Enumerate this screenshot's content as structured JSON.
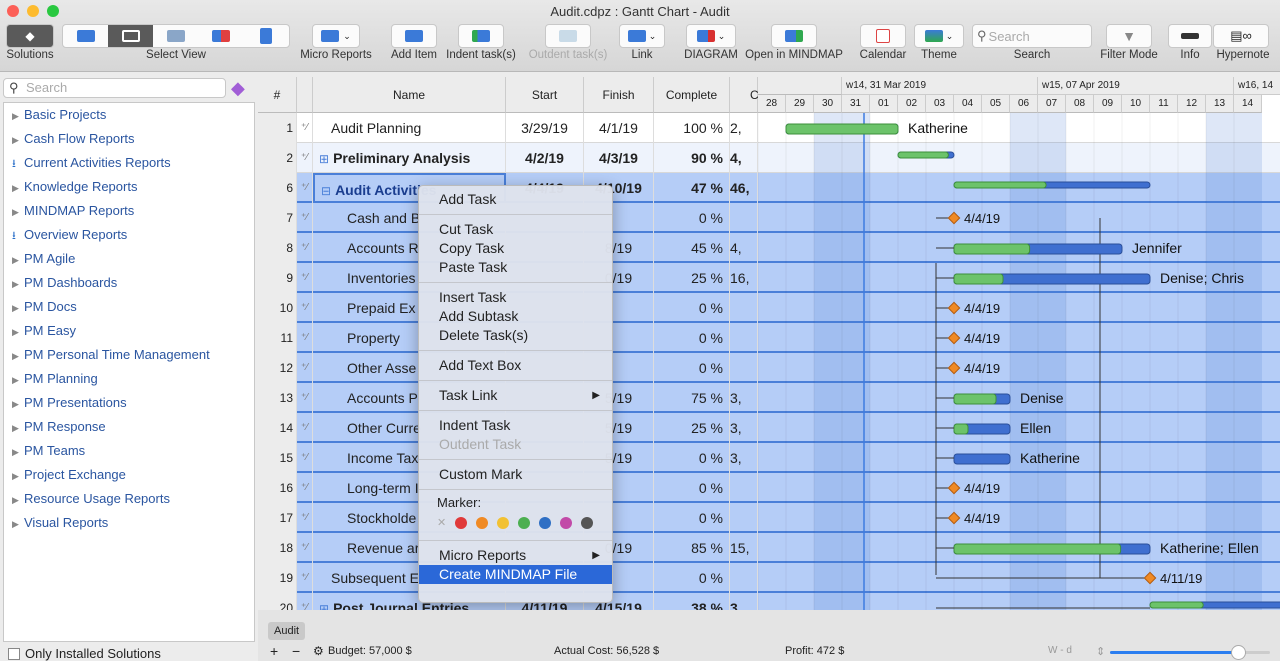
{
  "window": {
    "title": "Audit.cdpz : Gantt Chart - Audit"
  },
  "toolbar": {
    "solutions": "Solutions",
    "select_view": "Select View",
    "micro_reports": "Micro Reports",
    "add_item": "Add Item",
    "indent": "Indent task(s)",
    "outdent": "Outdent task(s)",
    "link": "Link",
    "diagram": "DIAGRAM",
    "open_mindmap": "Open in MINDMAP",
    "calendar": "Calendar",
    "theme": "Theme",
    "search_placeholder": "Search",
    "search": "Search",
    "filter_mode": "Filter Mode",
    "info": "Info",
    "hypernote": "Hypernote"
  },
  "sidebar": {
    "search_placeholder": "Search",
    "items": [
      {
        "label": "Basic Projects",
        "icon": "triangle"
      },
      {
        "label": "Cash Flow Reports",
        "icon": "triangle"
      },
      {
        "label": "Current Activities Reports",
        "icon": "download"
      },
      {
        "label": "Knowledge Reports",
        "icon": "triangle"
      },
      {
        "label": "MINDMAP Reports",
        "icon": "triangle"
      },
      {
        "label": "Overview Reports",
        "icon": "download"
      },
      {
        "label": "PM Agile",
        "icon": "triangle"
      },
      {
        "label": "PM Dashboards",
        "icon": "triangle"
      },
      {
        "label": "PM Docs",
        "icon": "triangle"
      },
      {
        "label": "PM Easy",
        "icon": "triangle"
      },
      {
        "label": "PM Personal Time Management",
        "icon": "triangle"
      },
      {
        "label": "PM Planning",
        "icon": "triangle"
      },
      {
        "label": "PM Presentations",
        "icon": "triangle"
      },
      {
        "label": "PM Response",
        "icon": "triangle"
      },
      {
        "label": "PM Teams",
        "icon": "triangle"
      },
      {
        "label": "Project Exchange",
        "icon": "triangle"
      },
      {
        "label": "Resource Usage Reports",
        "icon": "triangle"
      },
      {
        "label": "Visual Reports",
        "icon": "triangle"
      }
    ],
    "only_installed": "Only Installed Solutions"
  },
  "table": {
    "headers": {
      "num": "#",
      "name": "Name",
      "start": "Start",
      "finish": "Finish",
      "complete": "Complete",
      "cost": "C"
    },
    "rows": [
      {
        "num": "1",
        "name": "Audit Planning",
        "start": "3/29/19",
        "finish": "4/1/19",
        "complete": "100 %",
        "cost": "2,",
        "bold": false,
        "expander": "",
        "type": "bar",
        "s": "2019-03-29",
        "e": "2019-04-01",
        "progress": 100,
        "resource": "Katherine"
      },
      {
        "num": "2",
        "name": "Preliminary Analysis",
        "start": "4/2/19",
        "finish": "4/3/19",
        "complete": "90 %",
        "cost": "4,",
        "bold": true,
        "expander": "+",
        "type": "summary",
        "s": "2019-04-02",
        "e": "2019-04-03",
        "progress": 90,
        "resource": ""
      },
      {
        "num": "6",
        "name": "Audit Activities",
        "start": "4/4/19",
        "finish": "4/10/19",
        "complete": "47 %",
        "cost": "46,",
        "bold": true,
        "expander": "−",
        "type": "summary",
        "s": "2019-04-04",
        "e": "2019-04-10",
        "progress": 47,
        "resource": ""
      },
      {
        "num": "7",
        "name": "Cash and B",
        "start": "",
        "finish": "",
        "complete": "0 %",
        "cost": "",
        "type": "milestone",
        "s": "2019-04-04",
        "resource": "4/4/19"
      },
      {
        "num": "8",
        "name": "Accounts R",
        "start": "",
        "finish": "8/19",
        "complete": "45 %",
        "cost": "4,",
        "type": "bar",
        "s": "2019-04-04",
        "e": "2019-04-09",
        "progress": 45,
        "resource": "Jennifer"
      },
      {
        "num": "9",
        "name": "Inventories",
        "start": "",
        "finish": "0/19",
        "complete": "25 %",
        "cost": "16,",
        "type": "bar",
        "s": "2019-04-04",
        "e": "2019-04-10",
        "progress": 25,
        "resource": "Denise; Chris"
      },
      {
        "num": "10",
        "name": "Prepaid Ex",
        "start": "",
        "finish": "",
        "complete": "0 %",
        "cost": "",
        "type": "milestone",
        "s": "2019-04-04",
        "resource": "4/4/19"
      },
      {
        "num": "11",
        "name": "Property",
        "start": "",
        "finish": "",
        "complete": "0 %",
        "cost": "",
        "type": "milestone",
        "s": "2019-04-04",
        "resource": "4/4/19"
      },
      {
        "num": "12",
        "name": "Other Asse",
        "start": "",
        "finish": "",
        "complete": "0 %",
        "cost": "",
        "type": "milestone",
        "s": "2019-04-04",
        "resource": "4/4/19"
      },
      {
        "num": "13",
        "name": "Accounts P",
        "start": "",
        "finish": "5/19",
        "complete": "75 %",
        "cost": "3,",
        "type": "bar",
        "s": "2019-04-04",
        "e": "2019-04-05",
        "progress": 75,
        "resource": "Denise"
      },
      {
        "num": "14",
        "name": "Other Curre",
        "start": "",
        "finish": "5/19",
        "complete": "25 %",
        "cost": "3,",
        "type": "bar",
        "s": "2019-04-04",
        "e": "2019-04-05",
        "progress": 25,
        "resource": "Ellen"
      },
      {
        "num": "15",
        "name": "Income Tax",
        "start": "",
        "finish": "5/19",
        "complete": "0 %",
        "cost": "3,",
        "type": "bar",
        "s": "2019-04-04",
        "e": "2019-04-05",
        "progress": 0,
        "resource": "Katherine"
      },
      {
        "num": "16",
        "name": "Long-term I",
        "start": "",
        "finish": "",
        "complete": "0 %",
        "cost": "",
        "type": "milestone",
        "s": "2019-04-04",
        "resource": "4/4/19"
      },
      {
        "num": "17",
        "name": "Stockholde",
        "start": "",
        "finish": "",
        "complete": "0 %",
        "cost": "",
        "type": "milestone",
        "s": "2019-04-04",
        "resource": "4/4/19"
      },
      {
        "num": "18",
        "name": "Revenue ar",
        "start": "",
        "finish": "0/19",
        "complete": "85 %",
        "cost": "15,",
        "type": "bar",
        "s": "2019-04-04",
        "e": "2019-04-10",
        "progress": 85,
        "resource": "Katherine; Ellen"
      },
      {
        "num": "19",
        "name": "Subsequent E",
        "start": "",
        "finish": "",
        "complete": "0 %",
        "cost": "",
        "type": "milestone",
        "s": "2019-04-11",
        "resource": "4/11/19"
      },
      {
        "num": "20",
        "name": "Post Journal Entries",
        "start": "4/11/19",
        "finish": "4/15/19",
        "complete": "38 %",
        "cost": "3.",
        "bold": true,
        "expander": "+",
        "type": "summary",
        "s": "2019-04-11",
        "e": "2019-04-15",
        "progress": 38,
        "resource": ""
      }
    ]
  },
  "timeline": {
    "weeks": [
      "w14, 31 Mar 2019",
      "w15, 07 Apr 2019",
      "w16, 14"
    ],
    "days": [
      "28",
      "29",
      "30",
      "31",
      "01",
      "02",
      "03",
      "04",
      "05",
      "06",
      "07",
      "08",
      "09",
      "10",
      "11",
      "12",
      "13",
      "14"
    ],
    "today": "2019-03-31"
  },
  "context_menu": {
    "items": [
      {
        "label": "Add Task"
      },
      {
        "sep": true
      },
      {
        "label": "Cut Task"
      },
      {
        "label": "Copy Task"
      },
      {
        "label": "Paste Task"
      },
      {
        "sep": true
      },
      {
        "label": "Insert Task"
      },
      {
        "label": "Add Subtask"
      },
      {
        "label": "Delete Task(s)"
      },
      {
        "sep": true
      },
      {
        "label": "Add Text Box"
      },
      {
        "sep": true
      },
      {
        "label": "Task Link",
        "submenu": true
      },
      {
        "sep": true
      },
      {
        "label": "Indent Task"
      },
      {
        "label": "Outdent Task",
        "disabled": true
      },
      {
        "sep": true
      },
      {
        "label": "Custom Mark"
      },
      {
        "sep": true
      },
      {
        "marker": true
      },
      {
        "sep": true
      },
      {
        "label": "Micro Reports",
        "submenu": true
      },
      {
        "label": "Create MINDMAP File",
        "highlighted": true
      }
    ],
    "marker_label": "Marker:",
    "marker_colors": [
      "#e03a3a",
      "#f08a24",
      "#f2c132",
      "#4caf50",
      "#2f6fc4",
      "#c24aa8",
      "#555555"
    ]
  },
  "bottom": {
    "sheet_tab": "Audit",
    "budget": "Budget: 57,000 $",
    "actual_cost": "Actual Cost: 56,528 $",
    "profit": "Profit: 472 $",
    "scale": "W - d",
    "zoom_level": 0.8
  }
}
